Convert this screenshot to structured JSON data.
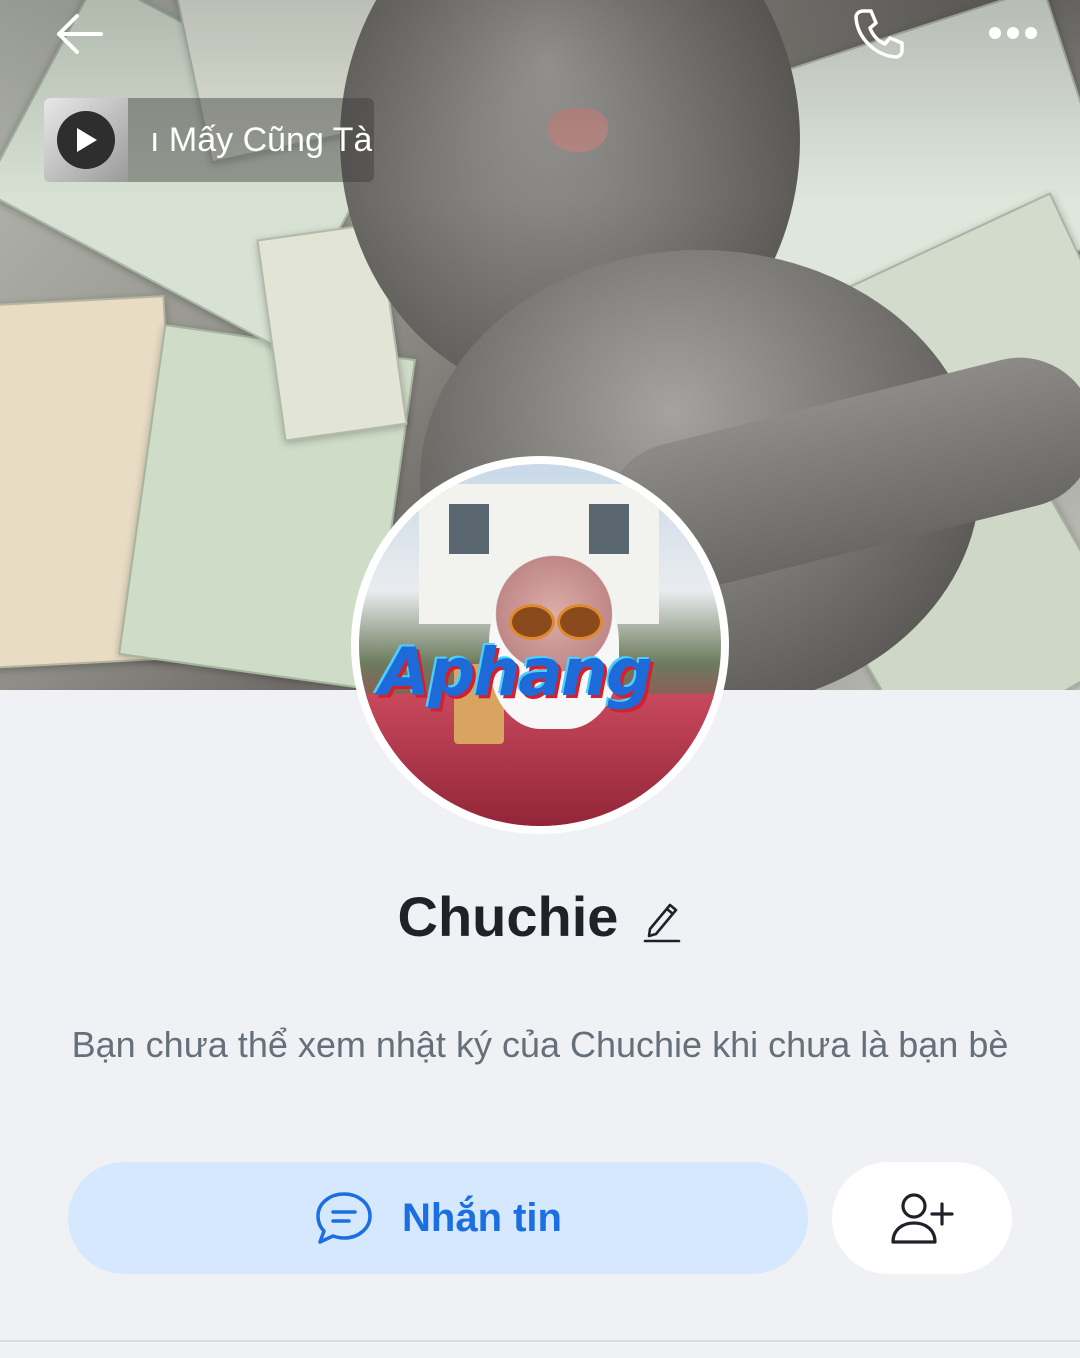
{
  "cover": {
    "watermark_text": "Aphang"
  },
  "header": {
    "back_icon": "arrow-left-icon",
    "call_icon": "phone-icon",
    "more_icon": "more-horizontal-icon"
  },
  "music": {
    "title": "ı Mấy Cũng Tà",
    "play_icon": "play-icon"
  },
  "profile": {
    "name": "Chuchie",
    "edit_icon": "pencil-icon",
    "notice": "Bạn chưa thể xem nhật ký của Chuchie khi chưa là bạn bè"
  },
  "actions": {
    "message_label": "Nhắn tin",
    "message_icon": "chat-bubble-icon",
    "add_friend_icon": "add-user-icon"
  },
  "colors": {
    "accent": "#1b6fe0",
    "message_button_bg": "#d6e8fd",
    "page_bg": "#eff1f5",
    "name_text": "#1f2329",
    "notice_text": "#66707a"
  }
}
